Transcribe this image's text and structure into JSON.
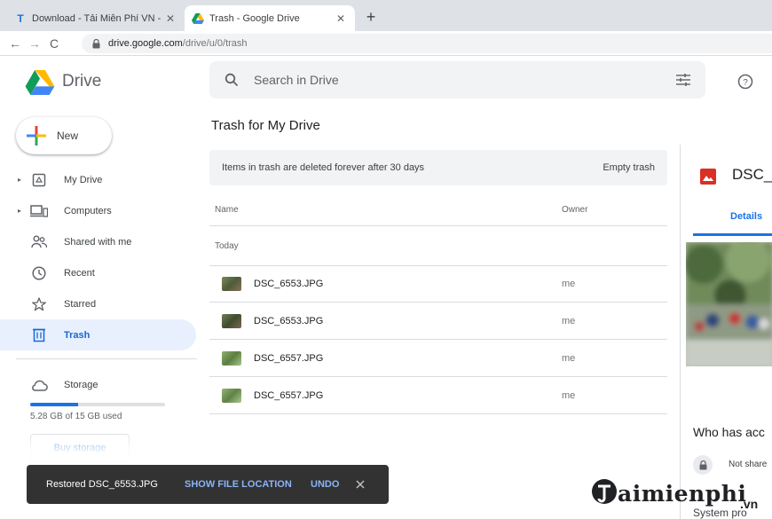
{
  "browser": {
    "tabs": [
      {
        "title": "Download - Tải Miễn Phí VN - Ph",
        "favicon": "T"
      },
      {
        "title": "Trash - Google Drive",
        "favicon": "drive-logo"
      }
    ],
    "url_domain": "drive.google.com",
    "url_path": "/drive/u/0/trash"
  },
  "header": {
    "brand": "Drive",
    "search_placeholder": "Search in Drive"
  },
  "sidebar": {
    "new_label": "New",
    "items": [
      {
        "label": "My Drive",
        "icon": "my-drive-icon",
        "caret": "▸"
      },
      {
        "label": "Computers",
        "icon": "computers-icon",
        "caret": "▸"
      },
      {
        "label": "Shared with me",
        "icon": "shared-icon"
      },
      {
        "label": "Recent",
        "icon": "clock-icon"
      },
      {
        "label": "Starred",
        "icon": "star-icon"
      },
      {
        "label": "Trash",
        "icon": "trash-icon",
        "active": true
      }
    ],
    "storage": {
      "label": "Storage",
      "used_text": "5.28 GB of 15 GB used",
      "used_fraction": 0.352,
      "buy_label": "Buy storage"
    }
  },
  "main": {
    "title": "Trash for My Drive",
    "banner_text": "Items in trash are deleted forever after 30 days",
    "empty_trash_label": "Empty trash",
    "columns": {
      "name": "Name",
      "owner": "Owner"
    },
    "group_label": "Today",
    "files": [
      {
        "name": "DSC_6553.JPG",
        "owner": "me"
      },
      {
        "name": "DSC_6553.JPG",
        "owner": "me"
      },
      {
        "name": "DSC_6557.JPG",
        "owner": "me"
      },
      {
        "name": "DSC_6557.JPG",
        "owner": "me"
      }
    ]
  },
  "details": {
    "file_name": "DSC_",
    "tab_label": "Details",
    "who_has_access": "Who has acc",
    "not_shared": "Not share",
    "system": "System pro"
  },
  "snackbar": {
    "message": "Restored DSC_6553.JPG",
    "show_location": "SHOW FILE LOCATION",
    "undo": "UNDO"
  },
  "watermark": {
    "brand": "aimienphi",
    "suffix": ".vn"
  },
  "colors": {
    "accent": "#1a73e8",
    "active_bg": "#e8f0fe",
    "snackbar_bg": "#323232",
    "link": "#8ab4f8"
  }
}
